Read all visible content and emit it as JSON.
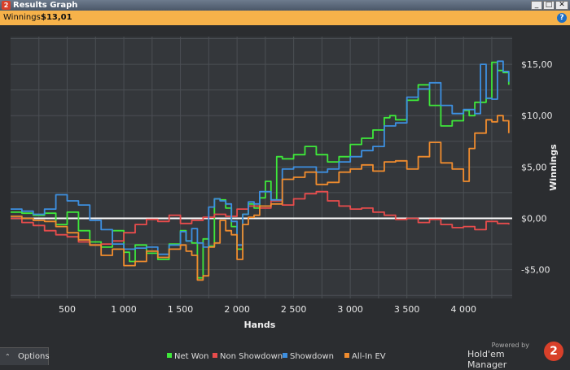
{
  "window": {
    "title": "Results Graph",
    "app_icon_text": "2",
    "buttons": {
      "minimize": "_",
      "maximize": "□",
      "close": "✕"
    }
  },
  "infobar": {
    "label": "Winnings:",
    "value": "$13,01",
    "help_icon": "?"
  },
  "chart_data": {
    "type": "line",
    "xlabel": "Hands",
    "ylabel": "Winnings",
    "xlim": [
      0,
      4430
    ],
    "ylim": [
      -7.8,
      17.7
    ],
    "x_ticks": [
      500,
      1000,
      1500,
      2000,
      2500,
      3000,
      3500,
      4000
    ],
    "x_tick_labels": [
      "500",
      "1 000",
      "1 500",
      "2 000",
      "2 500",
      "3 000",
      "3 500",
      "4 000"
    ],
    "y_ticks": [
      -5,
      0,
      5,
      10,
      15
    ],
    "y_tick_labels": [
      "-$5,00",
      "$0,00",
      "$5,00",
      "$10,00",
      "$15,00"
    ],
    "grid": true,
    "legend_position": "bottom",
    "series": [
      {
        "name": "Net Won",
        "color": "#3ee83a",
        "x": [
          0,
          100,
          200,
          300,
          400,
          500,
          600,
          700,
          800,
          900,
          1000,
          1050,
          1100,
          1200,
          1300,
          1400,
          1500,
          1550,
          1600,
          1650,
          1700,
          1750,
          1800,
          1850,
          1900,
          1950,
          2000,
          2050,
          2100,
          2150,
          2200,
          2250,
          2300,
          2350,
          2400,
          2500,
          2600,
          2700,
          2800,
          2900,
          3000,
          3100,
          3200,
          3300,
          3350,
          3400,
          3500,
          3600,
          3700,
          3800,
          3900,
          4000,
          4050,
          4100,
          4150,
          4200,
          4250,
          4300,
          4350,
          4400
        ],
        "y": [
          0.6,
          0.5,
          0.3,
          0.5,
          -0.6,
          0.6,
          -1.2,
          -2.3,
          -2.8,
          -1.2,
          -3.3,
          -4.2,
          -2.6,
          -3.4,
          -4.0,
          -2.5,
          -1.2,
          -2.2,
          -2.4,
          -5.8,
          -2.0,
          -2.7,
          1.9,
          1.8,
          1.0,
          -0.8,
          -3.0,
          0.4,
          1.4,
          1.0,
          2.0,
          3.6,
          1.8,
          6.0,
          5.8,
          6.2,
          7.0,
          6.2,
          5.5,
          6.0,
          7.2,
          7.8,
          8.6,
          9.8,
          10.0,
          9.6,
          11.5,
          13.0,
          11.0,
          9.0,
          9.5,
          10.5,
          10.0,
          11.3,
          11.3,
          11.7,
          15.2,
          14.4,
          14.2,
          13.0
        ]
      },
      {
        "name": "Non Showdown",
        "color": "#e84c4c",
        "x": [
          0,
          100,
          200,
          300,
          400,
          500,
          600,
          700,
          800,
          900,
          1000,
          1100,
          1200,
          1300,
          1400,
          1500,
          1600,
          1700,
          1800,
          1900,
          2000,
          2100,
          2200,
          2300,
          2400,
          2500,
          2600,
          2700,
          2800,
          2900,
          3000,
          3100,
          3200,
          3300,
          3400,
          3500,
          3600,
          3700,
          3800,
          3900,
          4000,
          4100,
          4200,
          4300,
          4400
        ],
        "y": [
          0.0,
          -0.4,
          -0.7,
          -1.2,
          -1.6,
          -1.8,
          -2.3,
          -2.6,
          -2.5,
          -2.2,
          -1.4,
          -0.6,
          -0.1,
          -0.3,
          0.3,
          -0.5,
          -0.2,
          0.1,
          0.4,
          0.2,
          0.9,
          1.2,
          1.0,
          1.7,
          1.3,
          1.9,
          2.4,
          2.6,
          1.7,
          1.2,
          0.9,
          1.0,
          0.6,
          0.3,
          -0.1,
          0.0,
          -0.4,
          -0.1,
          -0.6,
          -0.9,
          -0.8,
          -1.1,
          -0.3,
          -0.5,
          -0.6
        ]
      },
      {
        "name": "Showdown",
        "color": "#3d8fe0",
        "x": [
          0,
          100,
          200,
          300,
          400,
          500,
          600,
          700,
          800,
          900,
          1000,
          1100,
          1200,
          1300,
          1400,
          1500,
          1550,
          1600,
          1650,
          1700,
          1750,
          1800,
          1850,
          1900,
          1950,
          2000,
          2050,
          2100,
          2150,
          2200,
          2300,
          2400,
          2500,
          2600,
          2700,
          2800,
          2900,
          3000,
          3100,
          3200,
          3300,
          3400,
          3500,
          3600,
          3700,
          3800,
          3900,
          4000,
          4100,
          4150,
          4200,
          4250,
          4300,
          4350,
          4400
        ],
        "y": [
          0.9,
          0.7,
          0.4,
          0.9,
          2.3,
          1.7,
          1.3,
          -0.2,
          -1.1,
          -2.5,
          -3.0,
          -2.9,
          -2.8,
          -3.5,
          -2.6,
          -1.3,
          -2.2,
          -1.0,
          -2.4,
          -2.8,
          1.1,
          1.9,
          1.7,
          1.4,
          -0.3,
          -2.6,
          0.4,
          1.6,
          1.4,
          2.6,
          1.8,
          4.8,
          5.0,
          5.0,
          4.5,
          4.8,
          5.5,
          6.0,
          6.6,
          7.0,
          9.0,
          9.3,
          11.8,
          12.6,
          13.2,
          11.0,
          10.2,
          10.6,
          10.2,
          15.0,
          11.7,
          11.6,
          15.3,
          14.3,
          13.3
        ]
      },
      {
        "name": "All-In EV",
        "color": "#f08c2e",
        "x": [
          0,
          100,
          200,
          300,
          400,
          500,
          600,
          700,
          800,
          900,
          1000,
          1100,
          1200,
          1300,
          1400,
          1500,
          1550,
          1600,
          1650,
          1700,
          1750,
          1800,
          1850,
          1900,
          1950,
          2000,
          2050,
          2100,
          2150,
          2200,
          2300,
          2400,
          2500,
          2600,
          2700,
          2800,
          2900,
          3000,
          3100,
          3200,
          3300,
          3400,
          3500,
          3600,
          3700,
          3800,
          3900,
          4000,
          4050,
          4100,
          4150,
          4200,
          4250,
          4300,
          4350,
          4400
        ],
        "y": [
          0.2,
          0.0,
          -0.2,
          -0.3,
          -0.8,
          -1.4,
          -2.1,
          -2.6,
          -3.6,
          -3.0,
          -4.6,
          -4.2,
          -3.2,
          -3.8,
          -3.0,
          -2.6,
          -3.2,
          -3.6,
          -6.0,
          -5.6,
          -2.8,
          -2.4,
          -0.2,
          -1.2,
          -1.6,
          -4.0,
          -0.6,
          0.1,
          0.3,
          1.2,
          1.4,
          3.8,
          4.0,
          4.5,
          3.3,
          3.5,
          4.5,
          4.8,
          5.2,
          4.6,
          5.5,
          5.6,
          4.8,
          6.0,
          7.4,
          5.4,
          4.8,
          3.6,
          6.8,
          8.3,
          8.3,
          9.6,
          9.4,
          10.0,
          9.5,
          8.3
        ]
      }
    ]
  },
  "options": {
    "label": "Options",
    "caret": "⌃"
  },
  "branding": {
    "powered_by": "Powered by",
    "product": "Hold'em Manager",
    "logo_text": "2"
  }
}
